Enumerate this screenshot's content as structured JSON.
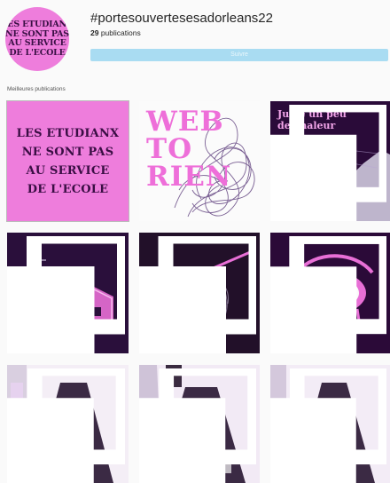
{
  "header": {
    "avatar_lines": [
      "LES ETUDIANX",
      "NE SONT PAS",
      "AU SERVICE",
      "DE L'ECOLE"
    ],
    "hashtag": "#portesouvertesesadorleans22",
    "count_number": "29",
    "count_label": " publications",
    "follow_label": "Suivre"
  },
  "top_posts": {
    "label": "Meilleures publications"
  },
  "posts": [
    {
      "name": "poster-etudianx",
      "lines": [
        "LES ETUDIANX",
        "NE SONT PAS",
        "AU SERVICE",
        "DE L'ECOLE"
      ]
    },
    {
      "name": "poster-web-to-rien",
      "lines": [
        "WEB",
        "TO",
        "RIEN"
      ]
    },
    {
      "name": "poster-juste-un-peu",
      "lines": [
        "Juste un peu",
        "de chaleur"
      ]
    },
    {
      "name": "code-house"
    },
    {
      "name": "scribble-dark"
    },
    {
      "name": "eye-drawing"
    },
    {
      "name": "hallway-1"
    },
    {
      "name": "hallway-2"
    },
    {
      "name": "hallway-3"
    }
  ],
  "colors": {
    "pink": "#ee7ddc",
    "purple": "#3a1045",
    "follow_blue": "#a9dcf2"
  },
  "icons": {
    "multi": "multiple-photos-icon"
  }
}
